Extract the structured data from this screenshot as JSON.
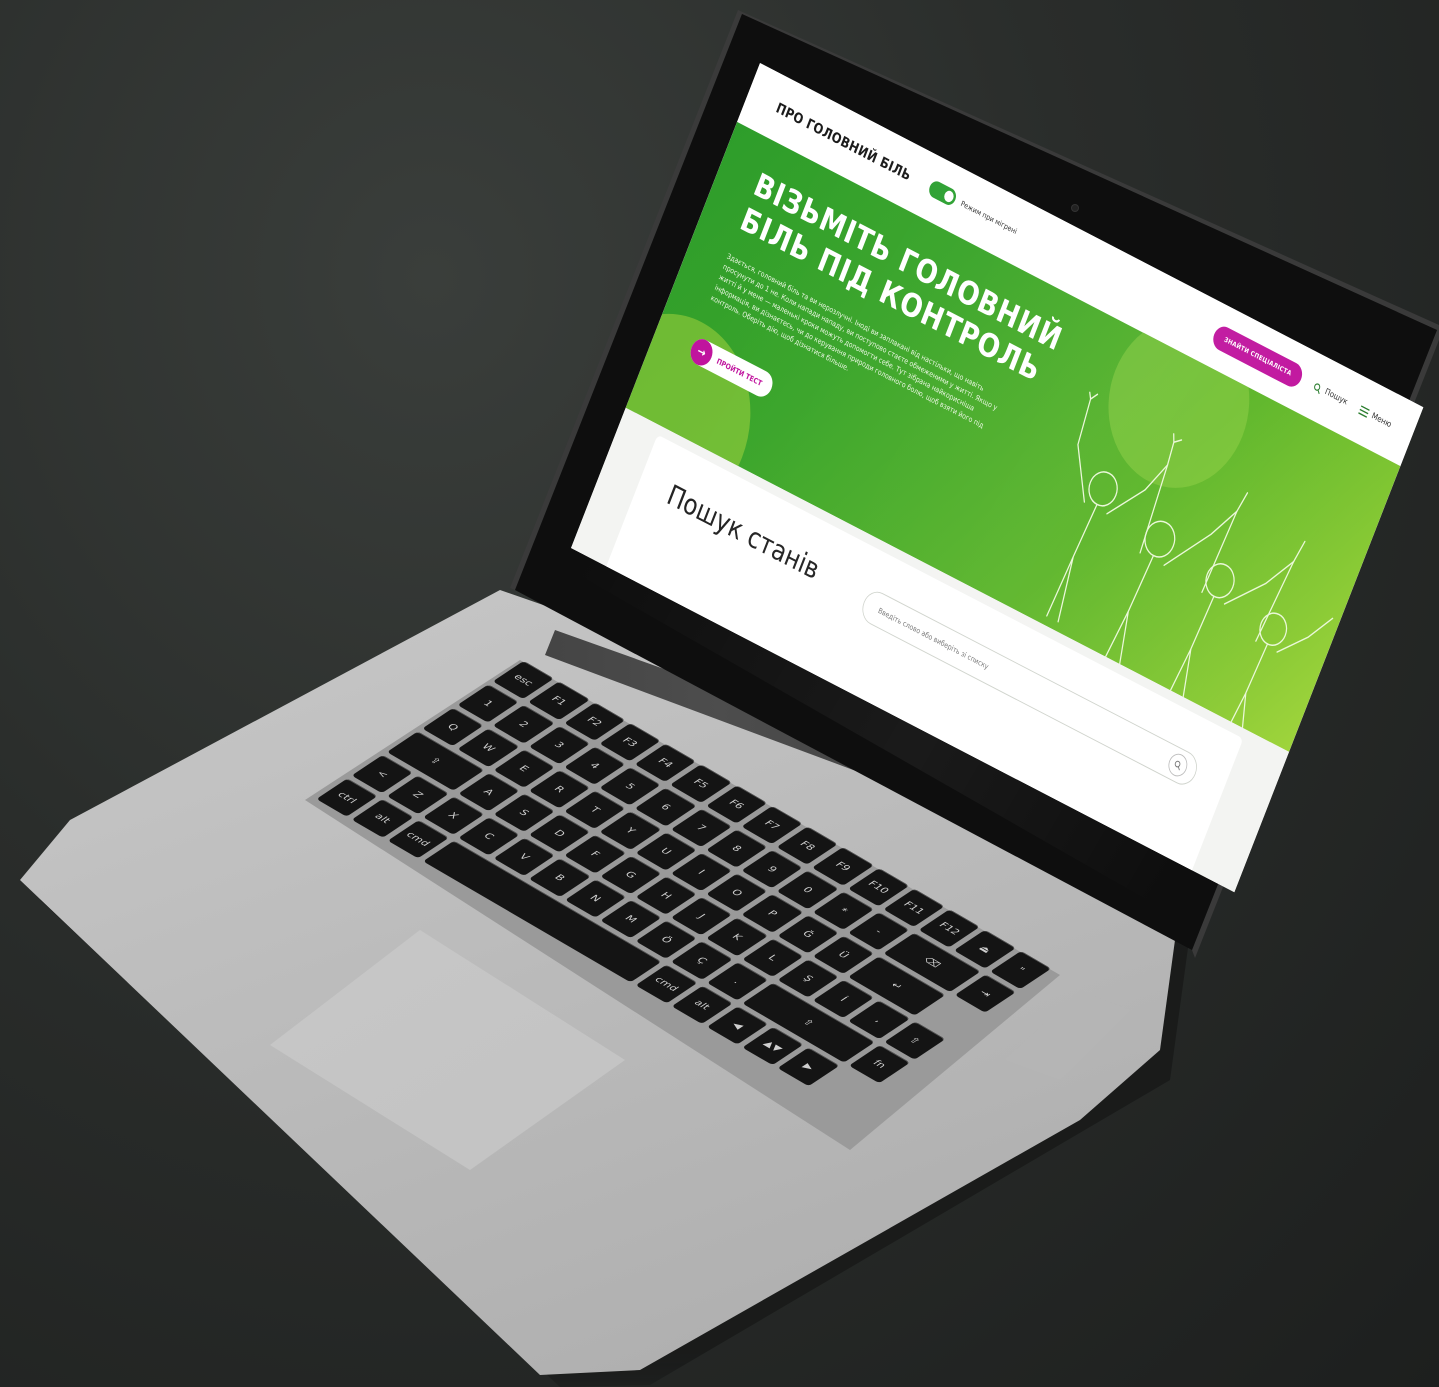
{
  "site": {
    "logo": "ПРО ГОЛОВНИЙ БІЛЬ",
    "toggle_label": "Режим при мігрені",
    "cta_label": "ЗНАЙТИ СПЕЦІАЛІСТА",
    "search_link": "Пошук",
    "menu_link": "Меню"
  },
  "hero": {
    "title": "ВІЗЬМІТЬ ГОЛОВНИЙ БІЛЬ ПІД КОНТРОЛЬ",
    "text": "Здається, головний біль та ви нерозлучні. Іноді ви заплакані від настільки, що навіть просунути до 1 не. Коли напади нападу, ви поступово стаєте обмеженими у житті. Якщо у житті й у мене — маленькі кроки можуть допомогти себе. Тут зібрана найкорисніша інформація, ви дізнаєтесь, чи до керування природи головного болю, щоб взяти його під контроль. Оберіть дію, щоб дізнатися більше.",
    "button_label": "ПРОЙТИ ТЕСТ"
  },
  "search": {
    "title": "Пошук станів",
    "placeholder": "Введіть слово або виберіть зі списку"
  },
  "colors": {
    "brand_green": "#2ea133",
    "accent_magenta": "#c0149e",
    "hero_light": "#9fd43c"
  },
  "icons": {
    "search": "search-icon",
    "menu": "hamburger-icon",
    "arrow": "arrow-right-icon"
  },
  "keyboard": {
    "rows": [
      [
        "esc",
        "F1",
        "F2",
        "F3",
        "F4",
        "F5",
        "F6",
        "F7",
        "F8",
        "F9",
        "F10",
        "F11",
        "F12",
        "⏏"
      ],
      [
        "\"",
        "1",
        "2",
        "3",
        "4",
        "5",
        "6",
        "7",
        "8",
        "9",
        "0",
        "*",
        "-",
        "⌫"
      ],
      [
        "⇥",
        "Q",
        "W",
        "E",
        "R",
        "T",
        "Y",
        "U",
        "I",
        "O",
        "P",
        "Ğ",
        "Ü",
        "↵"
      ],
      [
        "⇪",
        "A",
        "S",
        "D",
        "F",
        "G",
        "H",
        "J",
        "K",
        "L",
        "Ş",
        "İ",
        ","
      ],
      [
        "⇧",
        "<",
        "Z",
        "X",
        "C",
        "V",
        "B",
        "N",
        "M",
        "Ö",
        "Ç",
        ".",
        "⇧"
      ],
      [
        "fn",
        "ctrl",
        "alt",
        "cmd",
        "",
        "cmd",
        "alt",
        "◀",
        "▲▼",
        "▶"
      ]
    ]
  }
}
